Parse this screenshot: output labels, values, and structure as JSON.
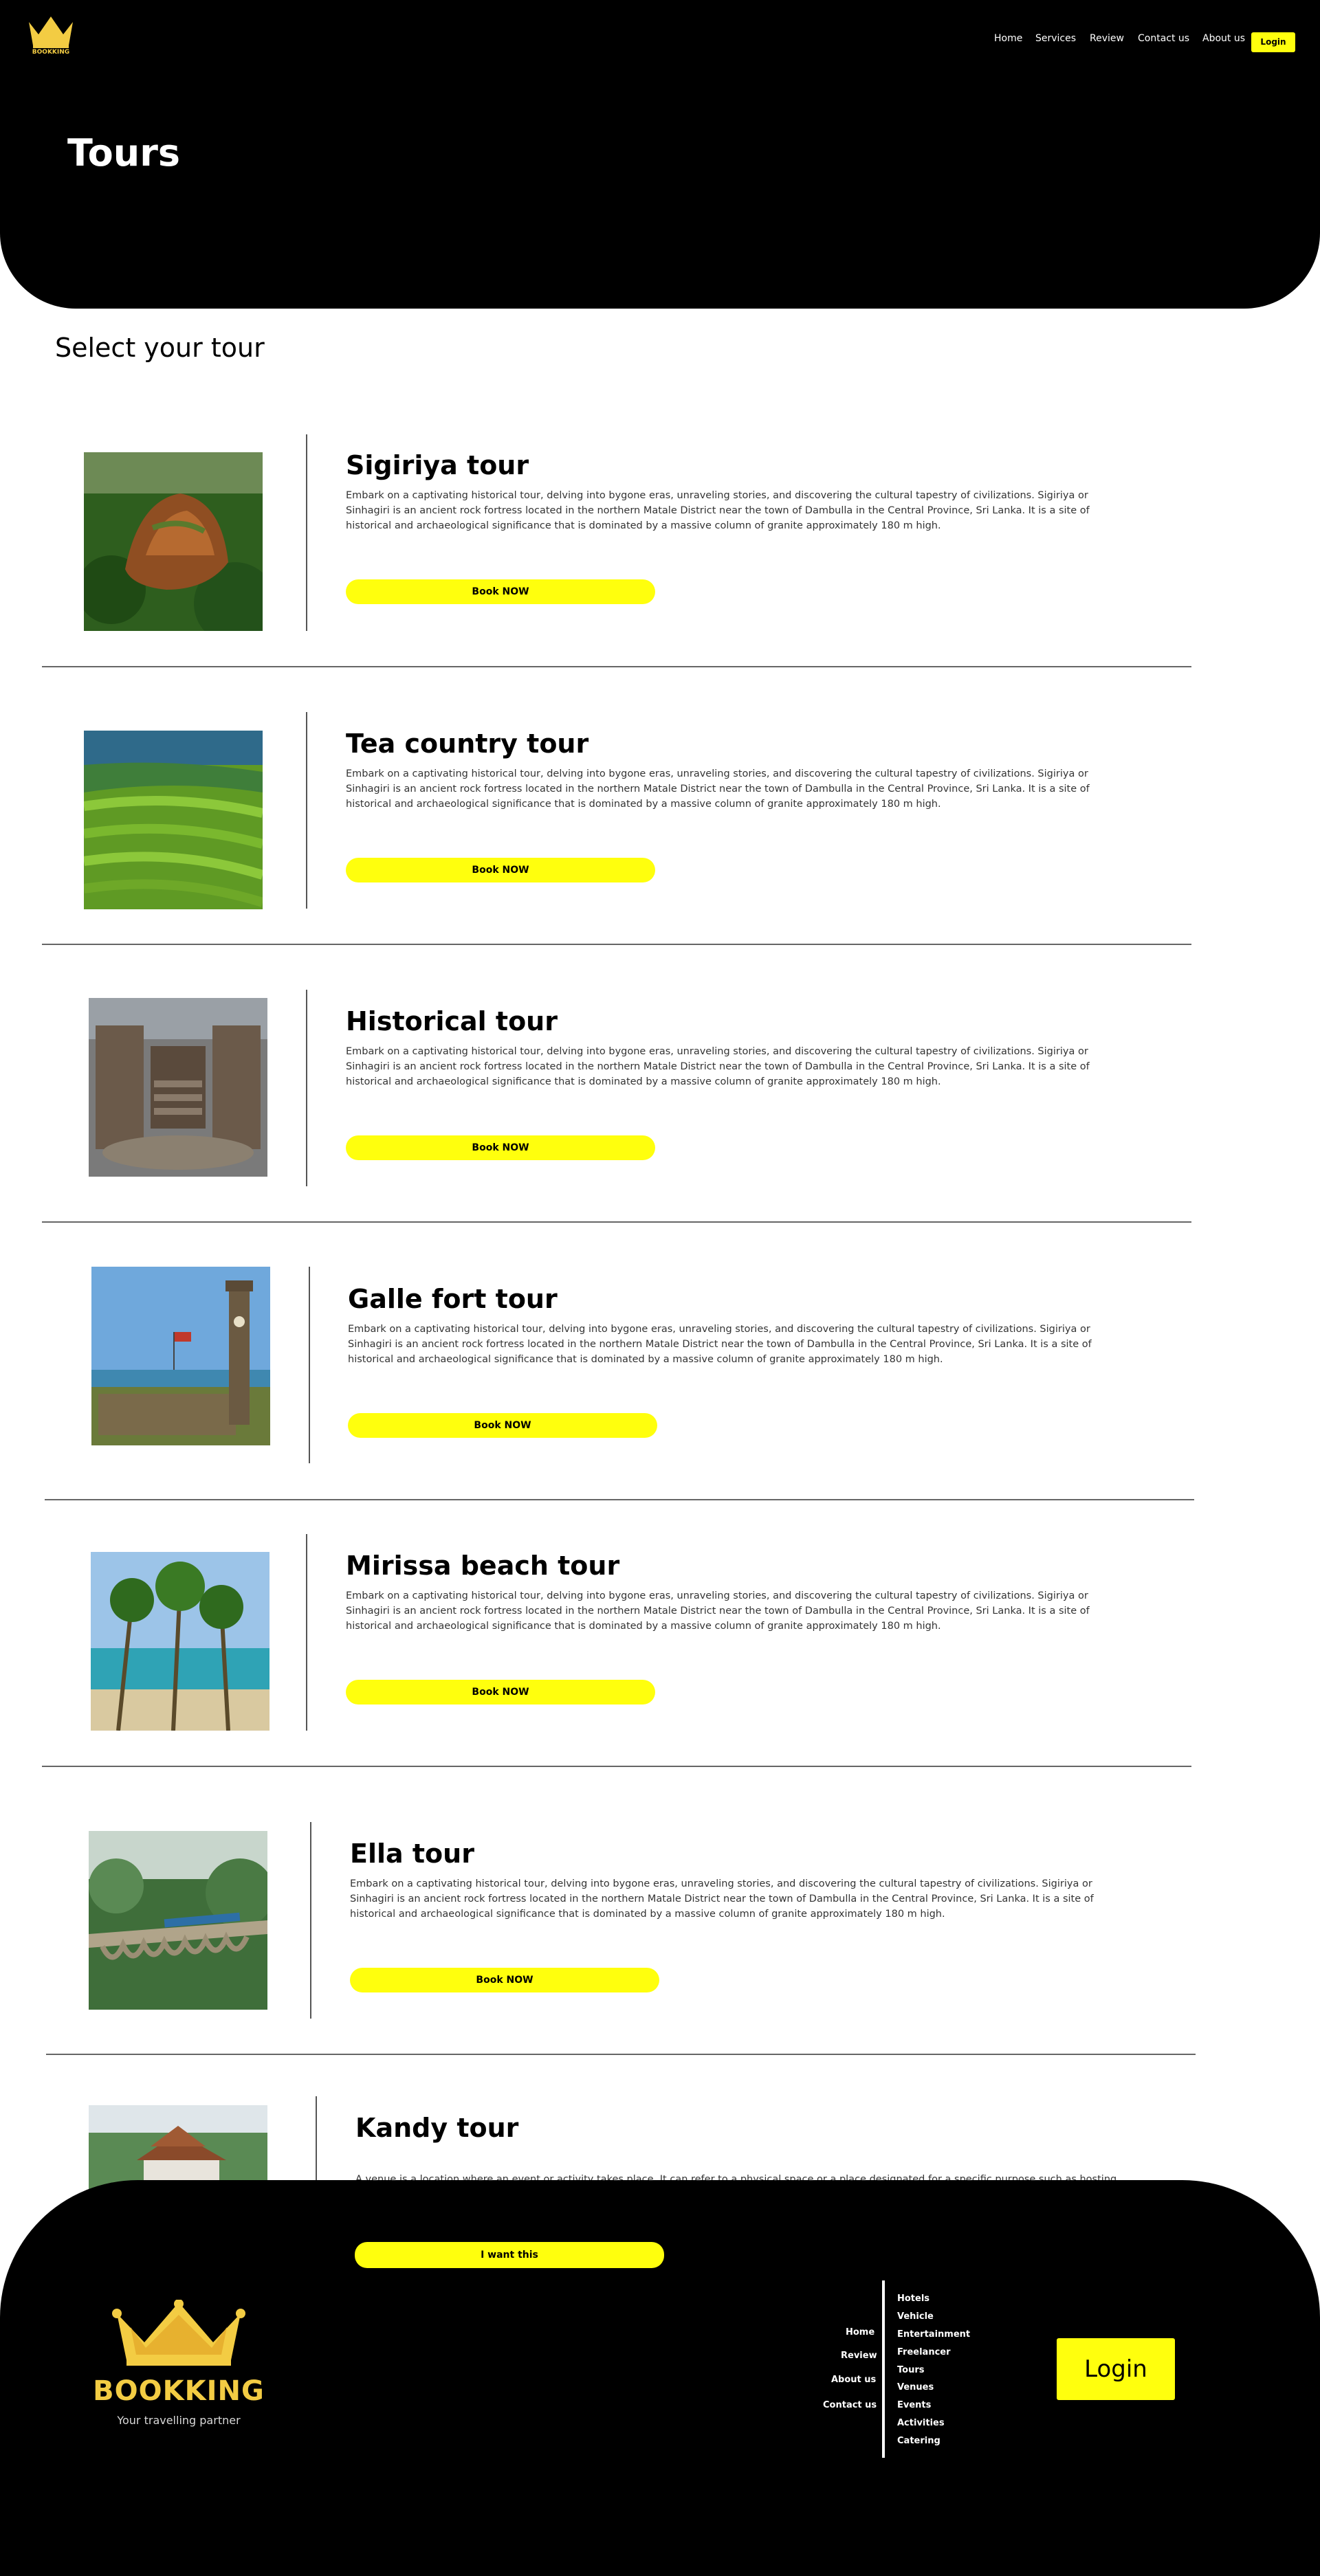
{
  "brand": {
    "name": "BOOKKING",
    "tagline": "Your travelling partner",
    "color_gold": "#f3cc43"
  },
  "nav": {
    "links": [
      "Home",
      "Services",
      "Review",
      "Contact us",
      "About us"
    ],
    "login": "Login"
  },
  "hero": {
    "title": "Tours"
  },
  "section": {
    "title": "Select your tour"
  },
  "tours": [
    {
      "title": "Sigiriya tour",
      "desc": "Embark on a captivating historical tour, delving into bygone eras, unraveling stories, and discovering the cultural tapestry of civilizations. Sigiriya or Sinhagiri is an ancient rock fortress located in the northern Matale District near the town of Dambulla in the Central Province, Sri Lanka. It is a site of historical and archaeological significance that is dominated by a massive column of granite approximately 180 m high.",
      "button": "Book NOW",
      "image": "sigiriya-rock"
    },
    {
      "title": "Tea country tour",
      "desc": "Embark on a captivating historical tour, delving into bygone eras, unraveling stories, and discovering the cultural tapestry of civilizations. Sigiriya or Sinhagiri is an ancient rock fortress located in the northern Matale District near the town of Dambulla in the Central Province, Sri Lanka. It is a site of historical and archaeological significance that is dominated by a massive column of granite approximately 180 m high.",
      "button": "Book NOW",
      "image": "tea-plantation"
    },
    {
      "title": "Historical tour",
      "desc": "Embark on a captivating historical tour, delving into bygone eras, unraveling stories, and discovering the cultural tapestry of civilizations. Sigiriya or Sinhagiri is an ancient rock fortress located in the northern Matale District near the town of Dambulla in the Central Province, Sri Lanka. It is a site of historical and archaeological significance that is dominated by a massive column of granite approximately 180 m high.",
      "button": "Book NOW",
      "image": "ancient-ruins"
    },
    {
      "title": "Galle fort tour",
      "desc": "Embark on a captivating historical tour, delving into bygone eras, unraveling stories, and discovering the cultural tapestry of civilizations. Sigiriya or Sinhagiri is an ancient rock fortress located in the northern Matale District near the town of Dambulla in the Central Province, Sri Lanka. It is a site of historical and archaeological significance that is dominated by a massive column of granite approximately 180 m high.",
      "button": "Book NOW",
      "image": "clock-tower"
    },
    {
      "title": "Mirissa beach tour",
      "desc": "Embark on a captivating historical tour, delving into bygone eras, unraveling stories, and discovering the cultural tapestry of civilizations. Sigiriya or Sinhagiri is an ancient rock fortress located in the northern Matale District near the town of Dambulla in the Central Province, Sri Lanka. It is a site of historical and archaeological significance that is dominated by a massive column of granite approximately 180 m high.",
      "button": "Book NOW",
      "image": "palm-beach"
    },
    {
      "title": "Ella tour",
      "desc": "Embark on a captivating historical tour, delving into bygone eras, unraveling stories, and discovering the cultural tapestry of civilizations. Sigiriya or Sinhagiri is an ancient rock fortress located in the northern Matale District near the town of Dambulla in the Central Province, Sri Lanka. It is a site of historical and archaeological significance that is dominated by a massive column of granite approximately 180 m high.",
      "button": "Book NOW",
      "image": "nine-arch-bridge"
    },
    {
      "title": "Kandy tour",
      "desc": "A venue is a location where an event or activity takes place. It can refer to a physical space or a place designated for a specific purpose such as hosting",
      "button": "I want this",
      "image": "temple"
    }
  ],
  "footer": {
    "links": [
      "Home",
      "Review",
      "About us",
      "Contact us"
    ],
    "services": [
      "Hotels",
      "Vehicle",
      "Entertainment",
      "Freelancer",
      "Tours",
      "Venues",
      "Events",
      "Activities",
      "Catering"
    ],
    "login": "Login"
  },
  "colors": {
    "accent": "#ffff0d",
    "dark": "#000000"
  }
}
